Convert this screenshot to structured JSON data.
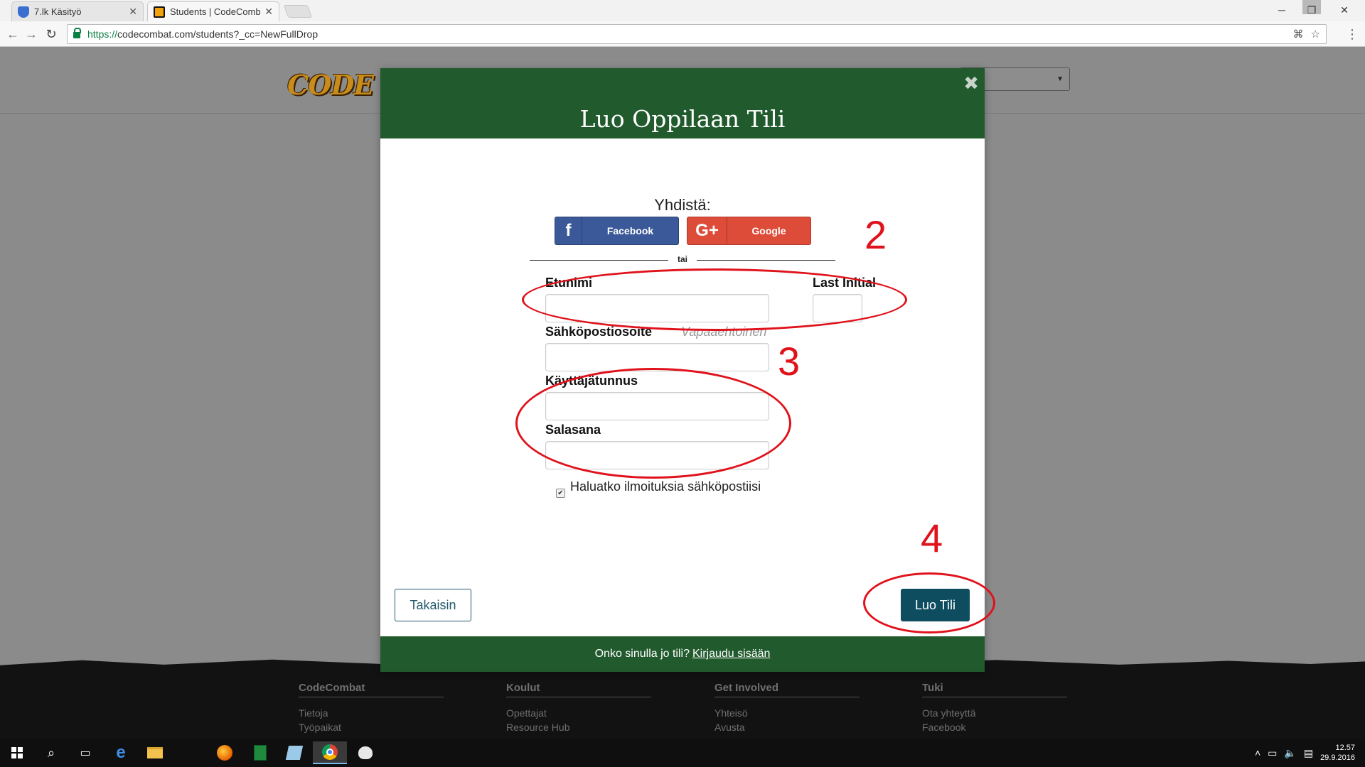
{
  "browser": {
    "tabs": [
      {
        "title": "7.lk Käsityö",
        "active": false
      },
      {
        "title": "Students | CodeCombat",
        "active": true
      }
    ],
    "url": {
      "scheme": "https://",
      "rest": "codecombat.com/students?_cc=NewFullDrop"
    }
  },
  "page": {
    "logo_text": "CODE CO",
    "footer": {
      "columns": [
        {
          "heading": "CodeCombat",
          "links": [
            "Tietoja",
            "Työpaikat"
          ]
        },
        {
          "heading": "Koulut",
          "links": [
            "Opettajat",
            "Resource Hub"
          ]
        },
        {
          "heading": "Get Involved",
          "links": [
            "Yhteisö",
            "Avusta"
          ]
        },
        {
          "heading": "Tuki",
          "links": [
            "Ota yhteyttä",
            "Facebook"
          ]
        }
      ]
    }
  },
  "modal": {
    "title": "Luo Oppilaan Tili",
    "close_glyph": "✖",
    "connect_label": "Yhdistä:",
    "facebook_label": "Facebook",
    "google_label": "Google",
    "or_text": "tai",
    "fields": {
      "first_name_label": "Etunimi",
      "last_initial_label": "Last Initial",
      "email_label": "Sähköpostiosoite",
      "email_hint": "Vapaaehtoinen",
      "username_label": "Käyttäjätunnus",
      "password_label": "Salasana"
    },
    "newsletter": {
      "label": "Haluatko ilmoituksia sähköpostiisi",
      "checked": true
    },
    "back_label": "Takaisin",
    "create_label": "Luo Tili",
    "footer_text": "Onko sinulla jo tili?",
    "footer_link": "Kirjaudu sisään"
  },
  "annotations": {
    "labels": [
      "2",
      "3",
      "4"
    ],
    "color": "#e0121b"
  },
  "taskbar": {
    "clock_time": "12.57",
    "clock_date": "29.9.2016"
  },
  "colors": {
    "modal_green": "#215a2d",
    "primary_button": "#0e4c60",
    "facebook": "#3b5998",
    "google": "#dd4b39"
  }
}
